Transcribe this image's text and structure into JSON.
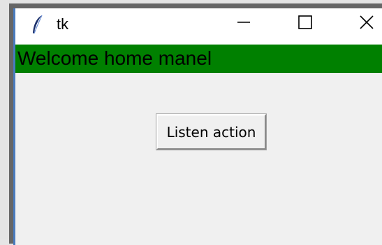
{
  "window": {
    "title": "tk",
    "icon": "tk-feather-icon"
  },
  "titlebar_buttons": {
    "minimize_icon": "minimize-icon",
    "maximize_icon": "maximize-icon",
    "close_icon": "close-icon"
  },
  "banner": {
    "text": "Welcome home manel",
    "background_color": "#008000"
  },
  "main": {
    "listen_button_label": "Listen action"
  }
}
